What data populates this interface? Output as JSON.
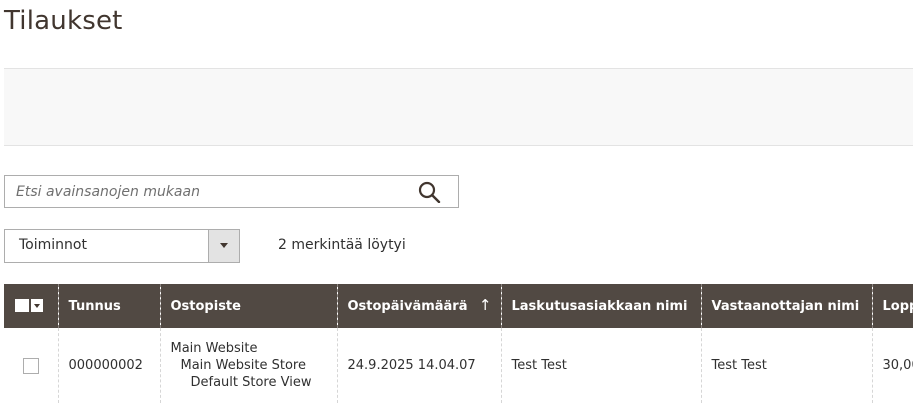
{
  "page": {
    "title": "Tilaukset"
  },
  "search": {
    "placeholder": "Etsi avainsanojen mukaan",
    "value": ""
  },
  "toolbar": {
    "actions_label": "Toiminnot",
    "records_found": "2 merkintää löytyi"
  },
  "grid": {
    "columns": [
      {
        "label": "Tunnus"
      },
      {
        "label": "Ostopiste"
      },
      {
        "label": "Ostopäivämäärä",
        "sort": "ascending",
        "sort_glyph": "↑"
      },
      {
        "label": "Laskutusasiakkaan nimi"
      },
      {
        "label": "Vastaanottajan nimi"
      },
      {
        "label": "Loppusumma"
      }
    ],
    "rows": [
      {
        "id": "000000002",
        "store": [
          "Main Website",
          "Main Website Store",
          "Default Store View"
        ],
        "purchase_date": "24.9.2025 14.04.07",
        "bill_to": "Test Test",
        "ship_to": "Test Test",
        "grand_total": "30,00"
      }
    ]
  },
  "colors": {
    "header_bg": "#514943",
    "title": "#41362f",
    "actions_bar_bg": "#f8f8f8"
  }
}
